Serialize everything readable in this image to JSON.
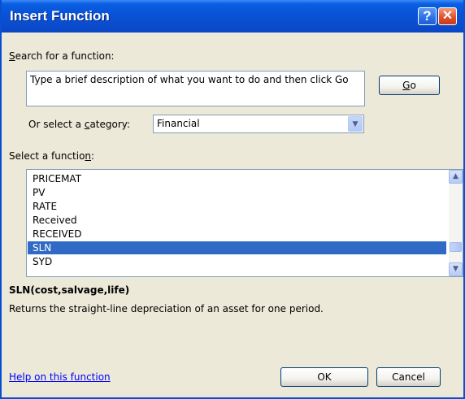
{
  "dialog": {
    "title": "Insert Function",
    "help_glyph": "?",
    "close_glyph": "✕"
  },
  "search": {
    "label_key": "S",
    "label_rest": "earch for a function:",
    "text": "Type a brief description of what you want to do and then click Go",
    "go_key": "G",
    "go_rest": "o"
  },
  "category": {
    "label_pre": "Or select a ",
    "label_key": "c",
    "label_post": "ategory:",
    "selected": "Financial"
  },
  "functions": {
    "label_pre": "Select a functio",
    "label_key": "n",
    "label_post": ":",
    "items": [
      "PRICEMAT",
      "PV",
      "RATE",
      "Received",
      "RECEIVED",
      "SLN",
      "SYD"
    ],
    "selected_index": 5,
    "scroll_position": 0.85
  },
  "details": {
    "syntax": "SLN(cost,salvage,life)",
    "description": "Returns the straight-line depreciation of an asset for one period."
  },
  "footer": {
    "help_link": "Help on this function",
    "ok_label": "OK",
    "cancel_label": "Cancel"
  },
  "icons": {
    "dropdown": "chevron-down-icon",
    "scroll_up": "chevron-up-icon",
    "scroll_down": "chevron-down-icon"
  },
  "colors": {
    "titlebar": "#0a53d8",
    "selection": "#316ac5",
    "dialog_bg": "#ece9d8",
    "link": "#0000ff"
  }
}
